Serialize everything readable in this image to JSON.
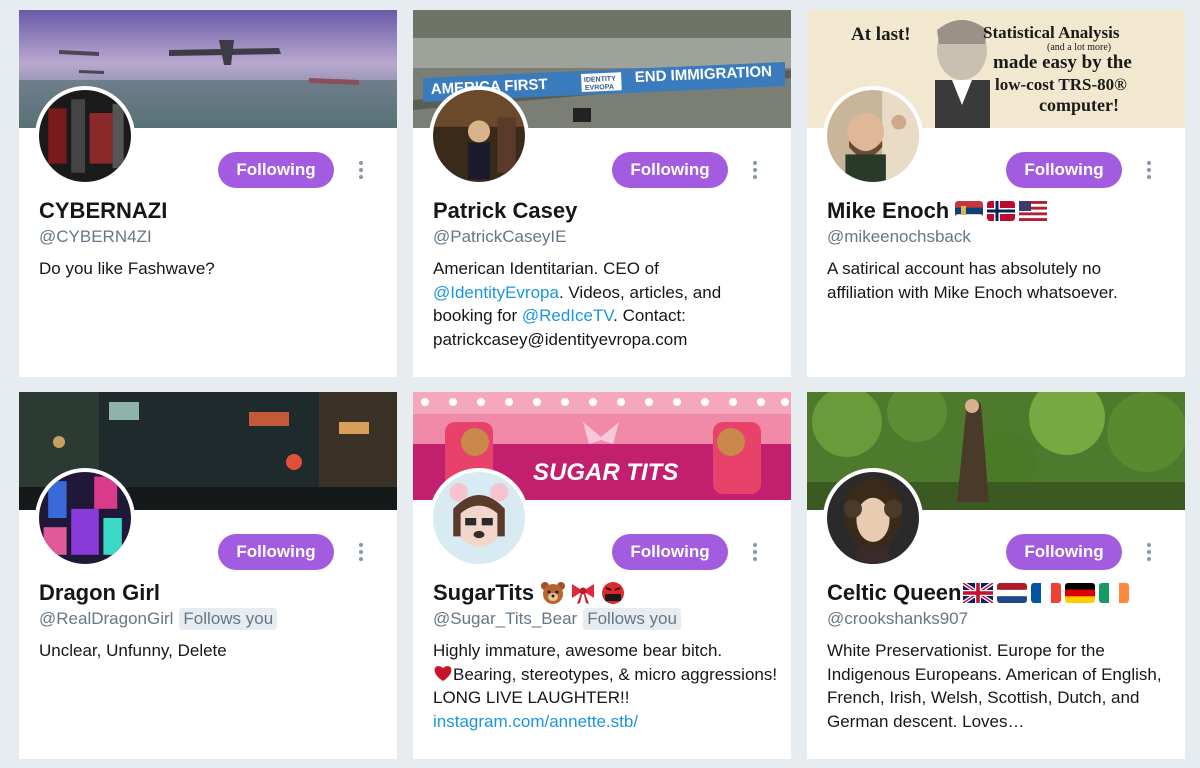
{
  "colors": {
    "background": "#e6ecf0",
    "following_button": "#a35be0",
    "link": "#1b95e0",
    "handle": "#657786"
  },
  "cards": [
    {
      "name": "CYBERNAZI",
      "handle": "@CYBERN4ZI",
      "follow_label": "Following",
      "follows_you": "",
      "bio": "Do you like Fashwave?",
      "icons": [
        "more-options-icon"
      ]
    },
    {
      "name": "Patrick Casey",
      "handle": "@PatrickCaseyIE",
      "follow_label": "Following",
      "follows_you": "",
      "bio_parts": {
        "t1": "American Identitarian. CEO of ",
        "link1": "@IdentityEvropa",
        "t2": ". Videos, articles, and booking for ",
        "link2": "@RedIceTV",
        "t3": ". Contact: patrickcasey@identityevropa.com"
      },
      "banner_text": {
        "left": "AMERICA FIRST",
        "badge_top": "IDENTITY",
        "badge_bottom": "EVROPA",
        "right": "END IMMIGRATION"
      }
    },
    {
      "name": "Mike Enoch",
      "handle": "@mikeenochsback",
      "follow_label": "Following",
      "follows_you": "",
      "bio": "A satirical account has absolutely no affiliation with Mike Enoch whatsoever.",
      "flags": [
        "serbia-flag-icon",
        "norway-flag-icon",
        "usa-flag-icon"
      ],
      "banner_text": {
        "at_last": "At last!",
        "line1": "Statistical Analysis",
        "line2": "(and a lot more)",
        "line3": "made easy by the",
        "line4": "low-cost TRS-80®",
        "line5": "computer!"
      }
    },
    {
      "name": "Dragon Girl",
      "handle": "@RealDragonGirl",
      "follow_label": "Following",
      "follows_you": "Follows you",
      "bio": "Unclear, Unfunny, Delete"
    },
    {
      "name": "SugarTits",
      "handle": "@Sugar_Tits_Bear",
      "follow_label": "Following",
      "follows_you": "Follows you",
      "emojis": [
        "bear-face-icon",
        "ribbon-icon",
        "cursing-face-icon"
      ],
      "bio_parts": {
        "t1": "Highly immature, awesome bear bitch.",
        "t2": "Bearing, stereotypes, & micro aggressions! LONG LIVE LAUGHTER!!",
        "link": "instagram.com/annette.stb/"
      },
      "banner_text": "SUGAR TITS"
    },
    {
      "name": "Celtic Queen",
      "handle": "@crookshanks907",
      "follow_label": "Following",
      "follows_you": "",
      "bio": "White Preservationist. Europe for the Indigenous Europeans. American of English, French, Irish, Welsh, Scottish, Dutch, and German descent. Loves…",
      "flags": [
        "uk-flag-icon",
        "netherlands-flag-icon",
        "france-flag-icon",
        "germany-flag-icon",
        "ireland-flag-icon"
      ]
    }
  ]
}
